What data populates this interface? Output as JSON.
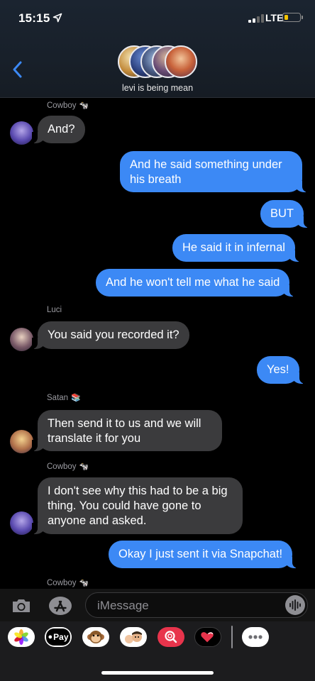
{
  "status_bar": {
    "time": "15:15",
    "network": "LTE"
  },
  "header": {
    "group_name": "levi is being mean"
  },
  "messages": [
    {
      "sender": "Cowboy",
      "sender_emoji": "🐄",
      "text": "And?"
    },
    {
      "text": "And he said something under his breath"
    },
    {
      "text": "BUT"
    },
    {
      "text": "He said it in infernal"
    },
    {
      "text": "And he won't tell me what he said"
    },
    {
      "sender": "Luci",
      "text": "You said you recorded it?"
    },
    {
      "text": "Yes!"
    },
    {
      "sender": "Satan",
      "sender_emoji": "📚",
      "text": "Then send it to us and we will translate it for you"
    },
    {
      "sender": "Cowboy",
      "sender_emoji": "🐄",
      "text": "I don't see why this had to be a big thing. You could have gone to anyone and asked."
    },
    {
      "text": "Okay I just sent it via Snapchat!"
    },
    {
      "sender": "Cowboy",
      "sender_emoji": "🐄"
    }
  ],
  "compose": {
    "placeholder": "iMessage"
  },
  "app_drawer": {
    "applepay_label": "Pay"
  },
  "colors": {
    "outgoing": "#3c89f5",
    "incoming": "#3b3b3d",
    "battery": "#f5c400"
  },
  "icons": [
    "location-arrow-icon",
    "signal-icon",
    "battery-icon",
    "back-chevron-icon",
    "camera-icon",
    "app-store-icon",
    "audio-waveform-icon",
    "photos-app-icon",
    "apple-pay-icon",
    "monkey-animoji-icon",
    "memoji-icon",
    "image-search-icon",
    "digital-touch-icon",
    "more-apps-icon"
  ]
}
